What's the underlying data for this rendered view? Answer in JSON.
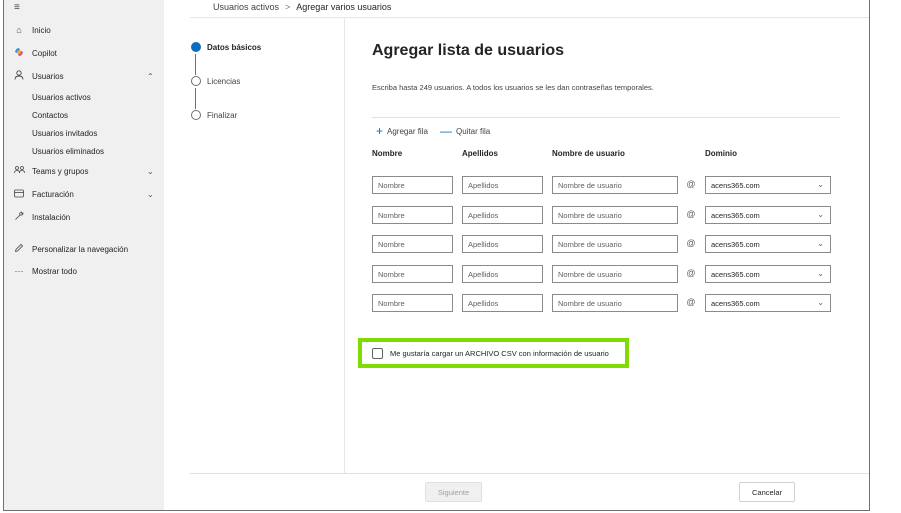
{
  "nav": {
    "menu_icon": "hamburger-icon",
    "items": [
      {
        "label": "Inicio",
        "icon": "home-icon"
      },
      {
        "label": "Copilot",
        "icon": "copilot-icon"
      },
      {
        "label": "Usuarios",
        "icon": "person-icon"
      },
      {
        "label": "Usuarios activos"
      },
      {
        "label": "Contactos"
      },
      {
        "label": "Usuarios invitados"
      },
      {
        "label": "Usuarios eliminados"
      },
      {
        "label": "Teams y grupos",
        "icon": "teams-icon"
      },
      {
        "label": "Facturación",
        "icon": "billing-icon"
      },
      {
        "label": "Instalación",
        "icon": "wrench-icon"
      },
      {
        "label": "Personalizar la navegación",
        "icon": "pencil-icon"
      },
      {
        "label": "Mostrar todo",
        "icon": "ellipsis-icon"
      }
    ]
  },
  "breadcrumb": {
    "parent": "Usuarios activos",
    "separator": ">",
    "current": "Agregar varios usuarios"
  },
  "steps": [
    {
      "label": "Datos básicos",
      "active": true
    },
    {
      "label": "Licencias",
      "active": false
    },
    {
      "label": "Finalizar",
      "active": false
    }
  ],
  "main": {
    "title": "Agregar lista de usuarios",
    "description": "Escriba hasta 249 usuarios. A todos los usuarios se les dan contraseñas temporales.",
    "add_row": "Agregar fila",
    "remove_row": "Quitar fila",
    "columns": {
      "first_name": "Nombre",
      "last_name": "Apellidos",
      "username": "Nombre de usuario",
      "domain": "Dominio"
    },
    "placeholders": {
      "first_name": "Nombre",
      "last_name": "Apellidos",
      "username": "Nombre de usuario"
    },
    "at_sign": "@",
    "rows": [
      {
        "domain": "acens365.com"
      },
      {
        "domain": "acens365.com"
      },
      {
        "domain": "acens365.com"
      },
      {
        "domain": "acens365.com"
      },
      {
        "domain": "acens365.com"
      }
    ],
    "csv_label": "Me gustaría cargar un ARCHIVO CSV con información de usuario",
    "highlight_color": "#7fdb00"
  },
  "footer": {
    "next": "Siguiente",
    "cancel": "Cancelar"
  },
  "colors": {
    "accent": "#0f6cbd",
    "nav_bg": "#f0f0f0"
  }
}
